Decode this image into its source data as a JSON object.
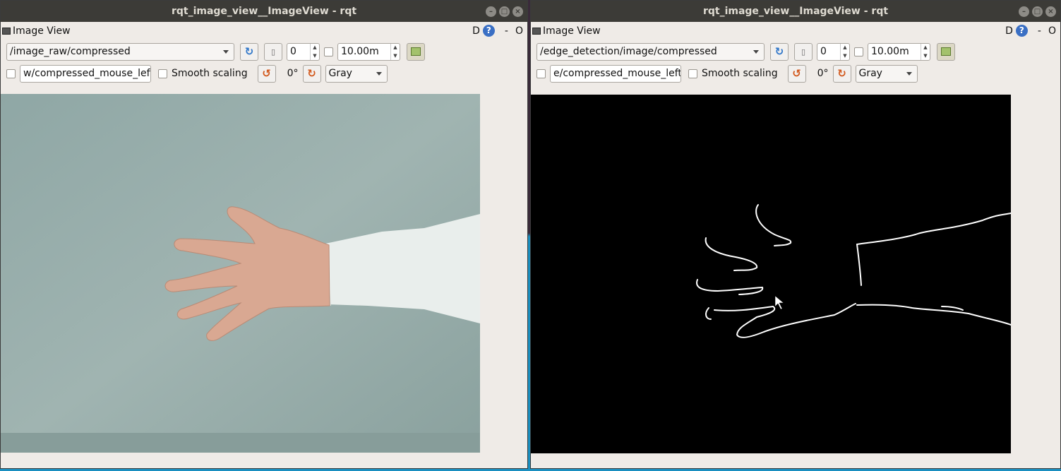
{
  "windows": [
    {
      "title": "rqt_image_view__ImageView - rqt",
      "plugin_title": "Image View",
      "plugin_right": {
        "d_label": "D",
        "help": "?",
        "dash": "-",
        "o_label": "O"
      },
      "topic": "/image_raw/compressed",
      "spin_value": "0",
      "rate_value": "10.00m",
      "mouse_topic": "w/compressed_mouse_left",
      "smooth_label": "Smooth scaling",
      "rotation": "0°",
      "color_scheme": "Gray",
      "view": "camera"
    },
    {
      "title": "rqt_image_view__ImageView - rqt",
      "plugin_title": "Image View",
      "plugin_right": {
        "d_label": "D",
        "help": "?",
        "dash": "-",
        "o_label": "O"
      },
      "topic": "/edge_detection/image/compressed",
      "spin_value": "0",
      "rate_value": "10.00m",
      "mouse_topic": "e/compressed_mouse_left",
      "smooth_label": "Smooth scaling",
      "rotation": "0°",
      "color_scheme": "Gray",
      "view": "edges"
    }
  ],
  "window_controls": [
    "–",
    "□",
    "×"
  ],
  "colors": {
    "titlebar": "#3c3b37",
    "window_bg": "#efebe7",
    "refresh_accent": "#2f76c9",
    "rotate_accent": "#d2581c"
  }
}
